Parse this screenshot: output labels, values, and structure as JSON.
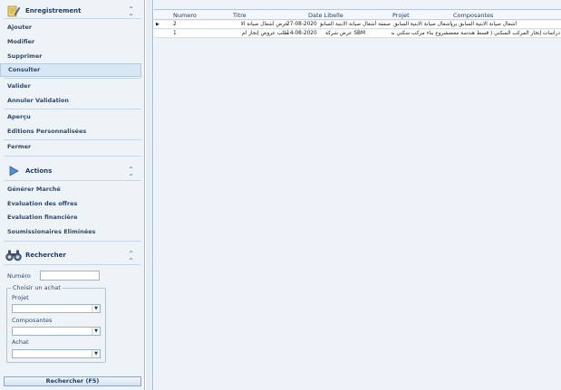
{
  "sidebar": {
    "enregistrement": {
      "title": "Enregistrement",
      "items": [
        {
          "label": "Ajouter"
        },
        {
          "label": "Modifier"
        },
        {
          "label": "Supprimer"
        },
        {
          "label": "Consulter",
          "selected": true
        },
        {
          "label": "Valider"
        },
        {
          "label": "Annuler Validation"
        },
        {
          "label": "Aperçu"
        },
        {
          "label": "Editions Personnalisées"
        },
        {
          "label": "Fermer"
        }
      ]
    },
    "actions": {
      "title": "Actions",
      "items": [
        {
          "label": "Générer Marché"
        },
        {
          "label": "Evaluation des offres"
        },
        {
          "label": "Evaluation financière"
        },
        {
          "label": "Soumissionaires Eliminées"
        }
      ]
    },
    "rechercher": {
      "title": "Rechercher",
      "numero_label": "Numéro",
      "numero_value": "",
      "fieldset_legend": "Choisir un achat",
      "projet_label": "Projet",
      "projet_value": "",
      "composantes_label": "Composantes",
      "composantes_value": "",
      "achat_label": "Achat",
      "achat_value": "",
      "button_label": "Rechercher (F5)"
    }
  },
  "grid": {
    "columns": [
      "Numero",
      "Titre",
      "Date Libelle",
      "Projet",
      "Composantes"
    ],
    "rows": [
      {
        "numero": "2",
        "titre": "عرض أشغال صيانة الا",
        "date": "27-08-2020",
        "libelle": "صفقة أشغال صيانة الابنية السابق",
        "projet": "أشغال صيانة الابنية السابق بروهل",
        "composantes": "أشغال صيانة الابنية السابق بروهل"
      },
      {
        "numero": "1",
        "titre": "طلب عروض إنجاز ام",
        "date": "14-08-2020",
        "libelle": "SBM عرض شركة",
        "projet": "مشروع بناء مركب سكني بد",
        "composantes": "دراسات إنجاز المركب السكني ( قسط هندسة معماري"
      }
    ]
  },
  "colors": {
    "panel_bg": "#eef3f8",
    "selected_bg": "#d9e6f4",
    "text": "#1e3a5f"
  },
  "icons": {
    "enregistrement": "notepad-pencil-icon",
    "actions": "play-arrow-icon",
    "rechercher": "binoculars-icon",
    "collapse": "double-chevron-up-icon",
    "row_indicator": "triangle-right-icon",
    "combo": "chevron-down-icon"
  }
}
